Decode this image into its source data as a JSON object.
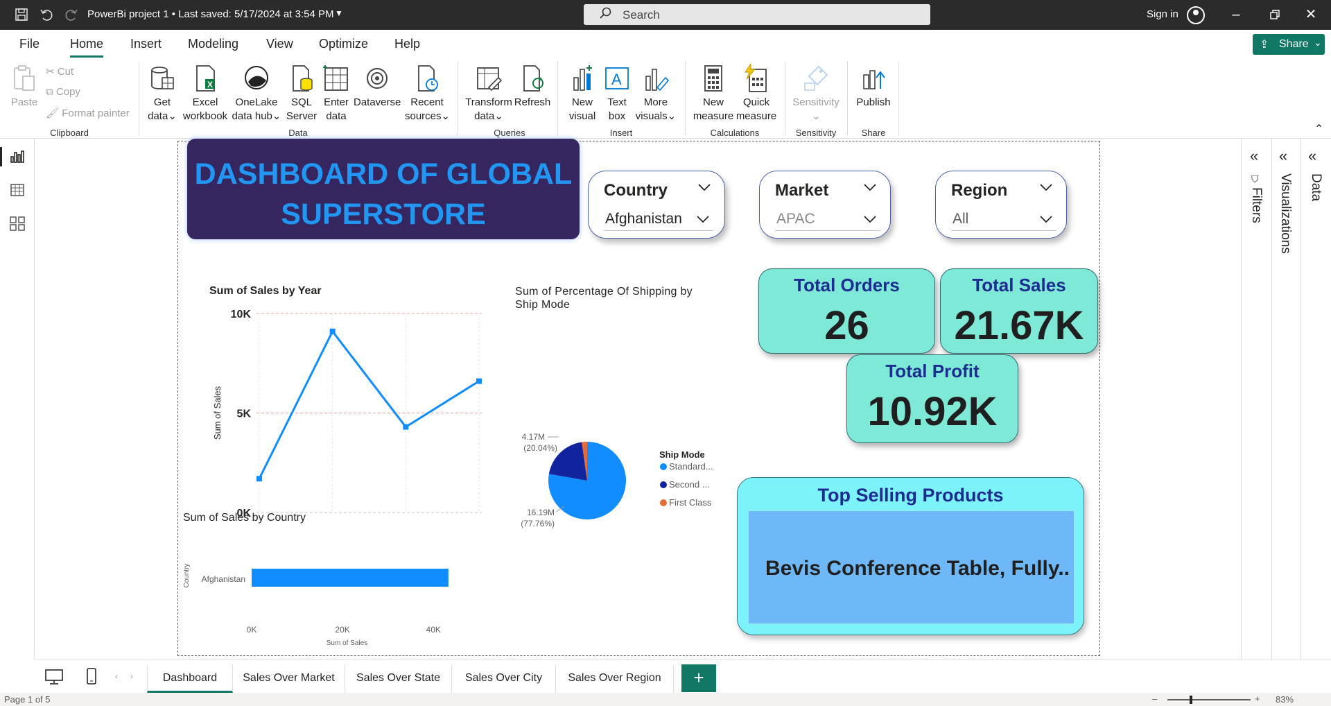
{
  "titlebar": {
    "title": "PowerBi project 1 • Last saved: 5/17/2024 at 3:54 PM",
    "search_placeholder": "Search",
    "sign_in": "Sign in"
  },
  "menu": {
    "items": [
      "File",
      "Home",
      "Insert",
      "Modeling",
      "View",
      "Optimize",
      "Help"
    ],
    "active": "Home",
    "share_label": "Share"
  },
  "ribbon": {
    "clipboard": {
      "paste": "Paste",
      "cut": "Cut",
      "copy": "Copy",
      "format_painter": "Format painter",
      "group": "Clipboard"
    },
    "data": {
      "get_data": [
        "Get",
        "data"
      ],
      "excel": [
        "Excel",
        "workbook"
      ],
      "onelake": [
        "OneLake",
        "data hub"
      ],
      "sql": [
        "SQL",
        "Server"
      ],
      "enter": [
        "Enter",
        "data"
      ],
      "dataverse": [
        "Dataverse"
      ],
      "recent": [
        "Recent",
        "sources"
      ],
      "group": "Data"
    },
    "queries": {
      "transform": [
        "Transform",
        "data"
      ],
      "refresh": [
        "Refresh"
      ],
      "group": "Queries"
    },
    "insert": {
      "new_visual": [
        "New",
        "visual"
      ],
      "text_box": [
        "Text",
        "box"
      ],
      "more_visuals": [
        "More",
        "visuals"
      ],
      "group": "Insert"
    },
    "calculations": {
      "new_measure": [
        "New",
        "measure"
      ],
      "quick_measure": [
        "Quick",
        "measure"
      ],
      "group": "Calculations"
    },
    "sensitivity": {
      "label": "Sensitivity",
      "group": "Sensitivity"
    },
    "share": {
      "publish": "Publish",
      "group": "Share"
    }
  },
  "report": {
    "title_line1": "DASHBOARD OF GLOBAL",
    "title_line2": "SUPERSTORE",
    "slicers": [
      {
        "header": "Country",
        "value": "Afghanistan"
      },
      {
        "header": "Market",
        "value": "APAC"
      },
      {
        "header": "Region",
        "value": "All"
      }
    ],
    "kpis": {
      "orders_label": "Total Orders",
      "orders_value": "26",
      "sales_label": "Total Sales",
      "sales_value": "21.67K",
      "profit_label": "Total Profit",
      "profit_value": "10.92K"
    },
    "top_products": {
      "title": "Top Selling Products",
      "value": "Bevis Conference Table, Fully.."
    }
  },
  "chart_data": [
    {
      "type": "line",
      "title": "Sum of Sales by Year",
      "xlabel": "",
      "ylabel": "Sum of Sales",
      "x": [
        "",
        "",
        "",
        ""
      ],
      "values": [
        1700,
        9100,
        4300,
        6600
      ],
      "ylim": [
        0,
        10000
      ],
      "yticks": [
        "0K",
        "5K",
        "10K"
      ],
      "color": "#118dff",
      "grid": true
    },
    {
      "type": "pie",
      "title": "Sum of Percentage Of Shipping by Ship Mode",
      "legend_title": "Ship Mode",
      "legend_position": "right",
      "slices": [
        {
          "label": "Standard...",
          "value": 16.19,
          "value_label": "16.19M",
          "pct_label": "(77.76%)",
          "color": "#118dff"
        },
        {
          "label": "Second ...",
          "value": 4.17,
          "value_label": "4.17M",
          "pct_label": "(20.04%)",
          "color": "#12239e"
        },
        {
          "label": "First Class",
          "value": 0.46,
          "value_label": "",
          "pct_label": "",
          "color": "#e66c37"
        }
      ]
    },
    {
      "type": "bar",
      "orientation": "horizontal",
      "title": "Sum of Sales by Country",
      "xlabel": "Sum of Sales",
      "ylabel": "Country",
      "categories": [
        "Afghanistan"
      ],
      "values": [
        43300
      ],
      "xticks": [
        "0K",
        "20K",
        "40K"
      ],
      "xlim": [
        0,
        45000
      ],
      "color": "#118dff"
    }
  ],
  "pages": {
    "tabs": [
      "Dashboard",
      "Sales Over Market",
      "Sales Over State",
      "Sales Over City",
      "Sales Over Region"
    ],
    "active": "Dashboard",
    "add": "+"
  },
  "panes": {
    "filters": "Filters",
    "visualizations": "Visualizations",
    "data": "Data"
  },
  "status": {
    "page": "Page 1 of 5",
    "zoom": "83%"
  }
}
